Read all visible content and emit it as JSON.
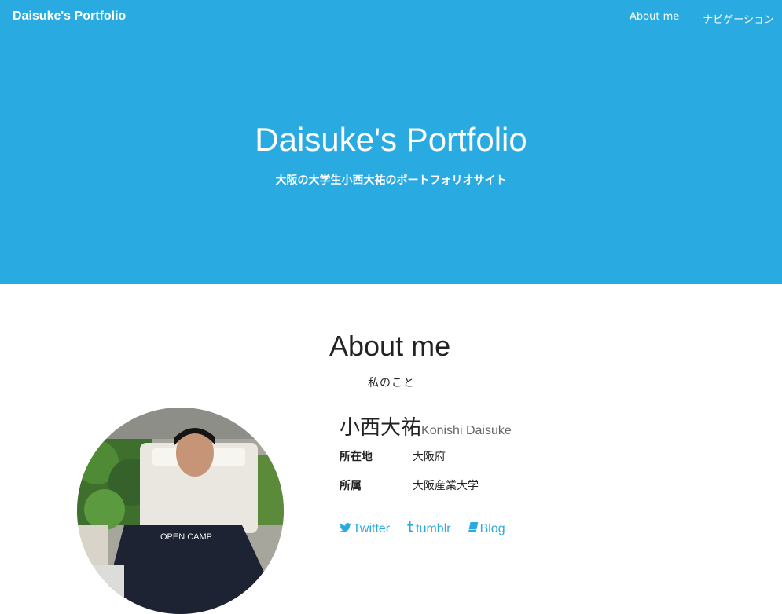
{
  "nav": {
    "brand": "Daisuke's Portfolio",
    "items": [
      {
        "label": "About me"
      },
      {
        "label": "ナビゲーション"
      }
    ]
  },
  "hero": {
    "title": "Daisuke's Portfolio",
    "subtitle": "大阪の大学生小西大祐のポートフォリオサイト",
    "background_color": "#29aae1"
  },
  "about": {
    "title": "About me",
    "subtitle": "私のこと",
    "name_jp": "小西大祐",
    "name_en": "Konishi Daisuke",
    "rows": [
      {
        "label": "所在地",
        "value": "大阪府"
      },
      {
        "label": "所属",
        "value": "大阪産業大学"
      }
    ],
    "links": [
      {
        "label": "Twitter",
        "icon": "twitter-icon"
      },
      {
        "label": "tumblr",
        "icon": "tumblr-icon"
      },
      {
        "label": "Blog",
        "icon": "book-icon"
      }
    ],
    "link_color": "#29aae1"
  }
}
